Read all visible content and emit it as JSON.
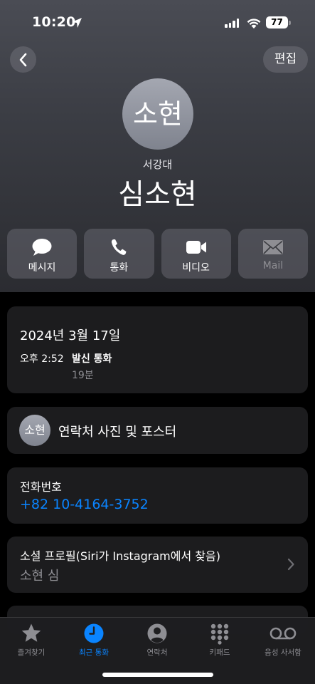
{
  "status_bar": {
    "time": "10:20",
    "battery": "77"
  },
  "nav": {
    "edit_label": "편집"
  },
  "contact": {
    "avatar_initials": "소현",
    "organization": "서강대",
    "name": "심소현"
  },
  "actions": [
    {
      "label": "메시지",
      "icon": "message-bubble-icon",
      "enabled": true
    },
    {
      "label": "통화",
      "icon": "phone-icon",
      "enabled": true
    },
    {
      "label": "비디오",
      "icon": "video-icon",
      "enabled": true
    },
    {
      "label": "Mail",
      "icon": "mail-icon",
      "enabled": false
    }
  ],
  "call_log": {
    "date": "2024년 3월 17일",
    "time": "오후 2:52",
    "type": "발신 통화",
    "duration": "19분"
  },
  "photo_poster": {
    "avatar_initials": "소현",
    "label": "연락처 사진 및 포스터"
  },
  "phone": {
    "label": "전화번호",
    "number": "+82 10-4164-3752"
  },
  "social_profile": {
    "label": "소셜 프로필(Siri가 Instagram에서 찾음)",
    "name": "소현 심"
  },
  "tabs": [
    {
      "label": "즐겨찾기",
      "icon": "star-icon",
      "active": false
    },
    {
      "label": "최근 통화",
      "icon": "clock-icon",
      "active": true
    },
    {
      "label": "연락처",
      "icon": "person-circle-icon",
      "active": false
    },
    {
      "label": "키패드",
      "icon": "keypad-icon",
      "active": false
    },
    {
      "label": "음성 사서함",
      "icon": "voicemail-icon",
      "active": false
    }
  ],
  "colors": {
    "accent": "#0a84ff",
    "card": "#1c1c1e",
    "secondary_text": "#8e8e93"
  }
}
